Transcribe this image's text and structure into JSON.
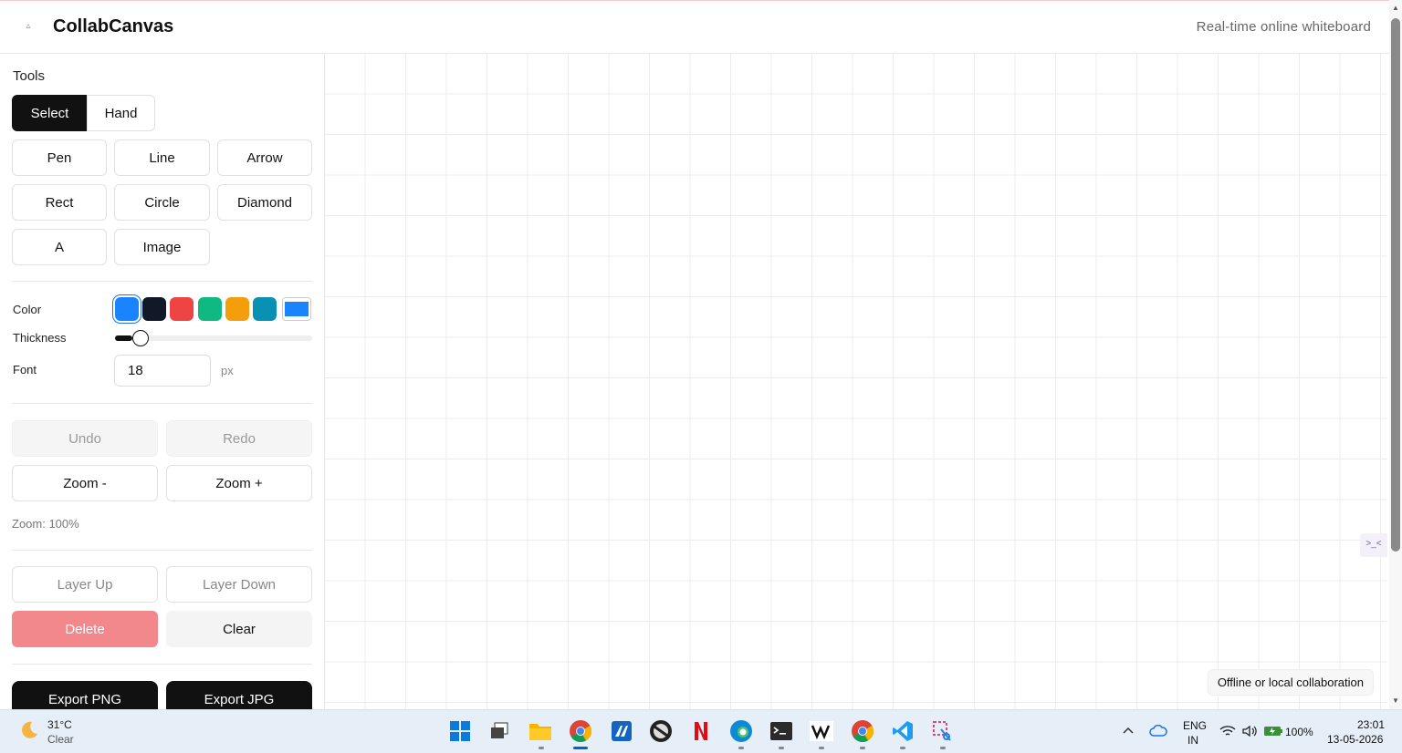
{
  "header": {
    "app_title": "CollabCanvas",
    "tagline": "Real-time online whiteboard"
  },
  "sidebar": {
    "tools_title": "Tools",
    "tools": {
      "select": "Select",
      "hand": "Hand",
      "pen": "Pen",
      "line": "Line",
      "arrow": "Arrow",
      "rect": "Rect",
      "circle": "Circle",
      "diamond": "Diamond",
      "text": "A",
      "image": "Image"
    },
    "active_tool": "Select",
    "color_label": "Color",
    "swatches": [
      "#1a84ff",
      "#111827",
      "#ef4444",
      "#10b981",
      "#f59e0b",
      "#0891b2"
    ],
    "selected_color": "#1a84ff",
    "thickness_label": "Thickness",
    "thickness_value": 0.09,
    "font_label": "Font",
    "font_size": "18",
    "font_unit": "px",
    "undo": "Undo",
    "redo": "Redo",
    "zoom_out": "Zoom -",
    "zoom_in": "Zoom +",
    "zoom_text": "Zoom: 100%",
    "layer_up": "Layer Up",
    "layer_down": "Layer Down",
    "delete": "Delete",
    "clear": "Clear",
    "export_png": "Export PNG",
    "export_jpg": "Export JPG"
  },
  "canvas": {
    "status": "Offline or local collaboration",
    "widget_glyph": ">_<"
  },
  "taskbar": {
    "weather_temp": "31°C",
    "weather_desc": "Clear",
    "lang_top": "ENG",
    "lang_bottom": "IN",
    "battery": "100%",
    "time": "23:01",
    "date": "13-05-2026",
    "apps": [
      "windows-start-icon",
      "task-view-icon",
      "file-explorer-icon",
      "chrome-icon",
      "app-icon",
      "obs-icon",
      "netflix-icon",
      "edge-icon",
      "terminal-icon",
      "app-w-icon",
      "chrome-profile-icon",
      "vscode-icon",
      "snipping-tool-icon"
    ]
  }
}
